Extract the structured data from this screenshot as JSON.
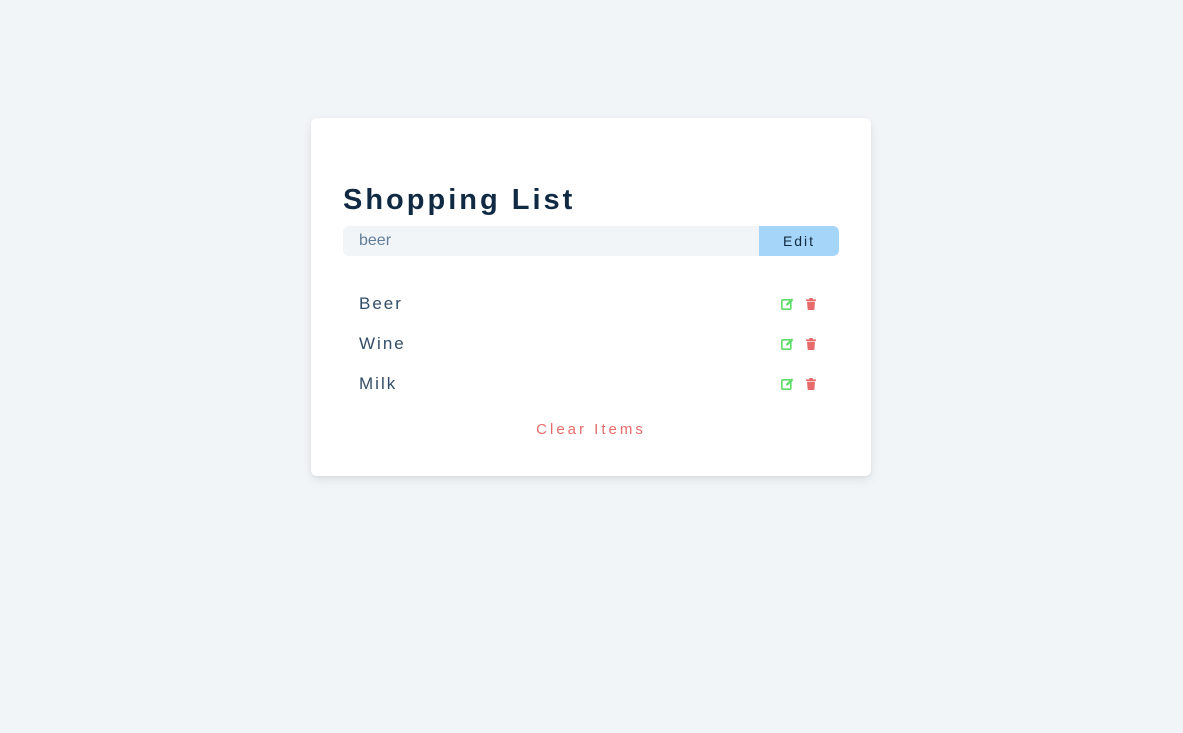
{
  "app": {
    "title": "Shopping List"
  },
  "form": {
    "input_value": "beer",
    "submit_label": "Edit"
  },
  "items": [
    {
      "title": "Beer",
      "edit_icon": "edit-icon",
      "delete_icon": "trash-icon"
    },
    {
      "title": "Wine",
      "edit_icon": "edit-icon",
      "delete_icon": "trash-icon"
    },
    {
      "title": "Milk",
      "edit_icon": "edit-icon",
      "delete_icon": "trash-icon"
    }
  ],
  "clear_label": "Clear Items",
  "colors": {
    "background": "#f1f5f8",
    "title": "#102a43",
    "edit_button": "#a5d5f8",
    "edit_icon": "#5ddc68",
    "delete_icon": "#e66b6b",
    "clear_text": "#e66b6b"
  }
}
